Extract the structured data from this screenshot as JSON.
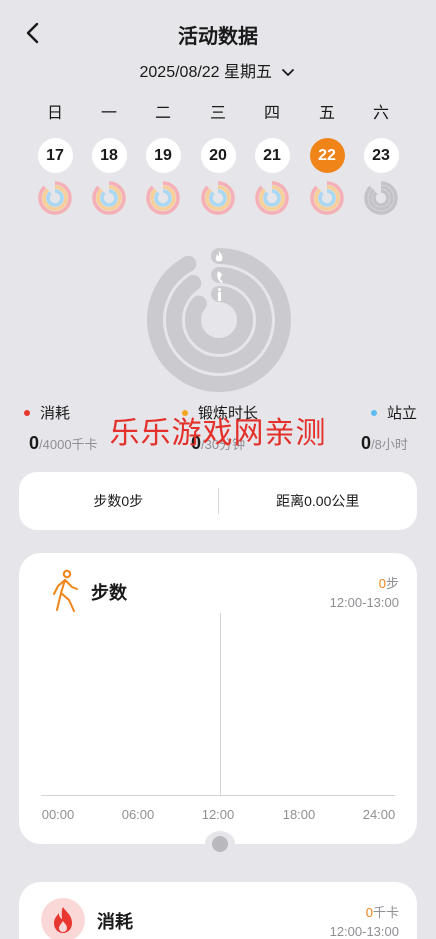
{
  "header": {
    "title": "活动数据",
    "back_icon": "chevron-left-icon"
  },
  "date_selector": {
    "label": "2025/08/22 星期五",
    "icon": "chevron-down-icon"
  },
  "week": {
    "days": [
      {
        "weekday": "日",
        "date": "17",
        "active": false,
        "has_data": true
      },
      {
        "weekday": "一",
        "date": "18",
        "active": false,
        "has_data": true
      },
      {
        "weekday": "二",
        "date": "19",
        "active": false,
        "has_data": true
      },
      {
        "weekday": "三",
        "date": "20",
        "active": false,
        "has_data": true
      },
      {
        "weekday": "四",
        "date": "21",
        "active": false,
        "has_data": true
      },
      {
        "weekday": "五",
        "date": "22",
        "active": true,
        "has_data": true
      },
      {
        "weekday": "六",
        "date": "23",
        "active": false,
        "has_data": false
      }
    ]
  },
  "rings": {
    "icons": [
      "flame-icon",
      "runner-icon",
      "standing-icon"
    ]
  },
  "stats": {
    "burn": {
      "label": "消耗",
      "value": "0",
      "target": "/4000千卡",
      "color": "#e8372f"
    },
    "exercise": {
      "label": "锻炼时长",
      "value": "0",
      "target": "/30分钟",
      "color": "#f5a524"
    },
    "stand": {
      "label": "站立",
      "value": "0",
      "target": "/8小时",
      "color": "#5bbcf0"
    }
  },
  "watermark": "乐乐游戏网亲测",
  "summary": {
    "steps": "步数0步",
    "distance": "距离0.00公里"
  },
  "steps_card": {
    "title": "步数",
    "value": "0",
    "unit": "步",
    "range": "12:00-13:00",
    "icon": "walking-person-icon",
    "axis": [
      "00:00",
      "06:00",
      "12:00",
      "18:00",
      "24:00"
    ]
  },
  "burn_card": {
    "title": "消耗",
    "value": "0",
    "unit": "千卡",
    "range": "12:00-13:00",
    "icon": "flame-icon"
  },
  "colors": {
    "accent": "#f08418",
    "background": "#e6e5ea"
  }
}
